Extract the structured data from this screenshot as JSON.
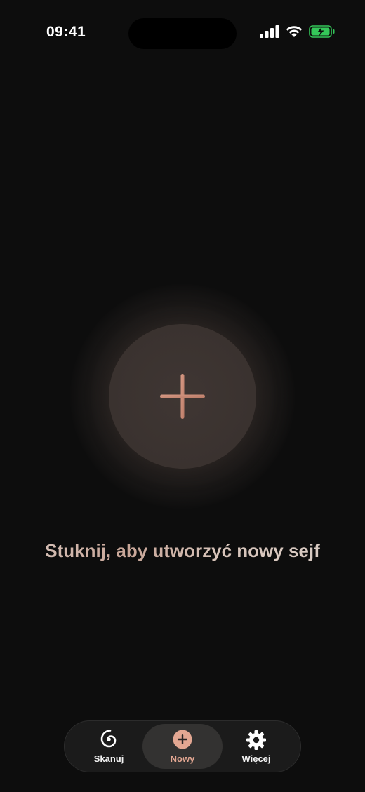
{
  "status_bar": {
    "time": "09:41",
    "icons": [
      "cellular-signal-icon",
      "wifi-icon",
      "battery-charging-icon"
    ],
    "battery_color": "#34c759"
  },
  "main": {
    "create_button_icon": "plus-icon",
    "hint": "Stuknij, aby utworzyć nowy sejf",
    "accent_color": "#c8907c"
  },
  "tab_bar": {
    "active_tab": "Nowy",
    "tabs": [
      {
        "label": "Skanuj",
        "icon": "spiral-icon"
      },
      {
        "label": "Nowy",
        "icon": "plus-circle-icon"
      },
      {
        "label": "Więcej",
        "icon": "gear-icon"
      }
    ]
  }
}
